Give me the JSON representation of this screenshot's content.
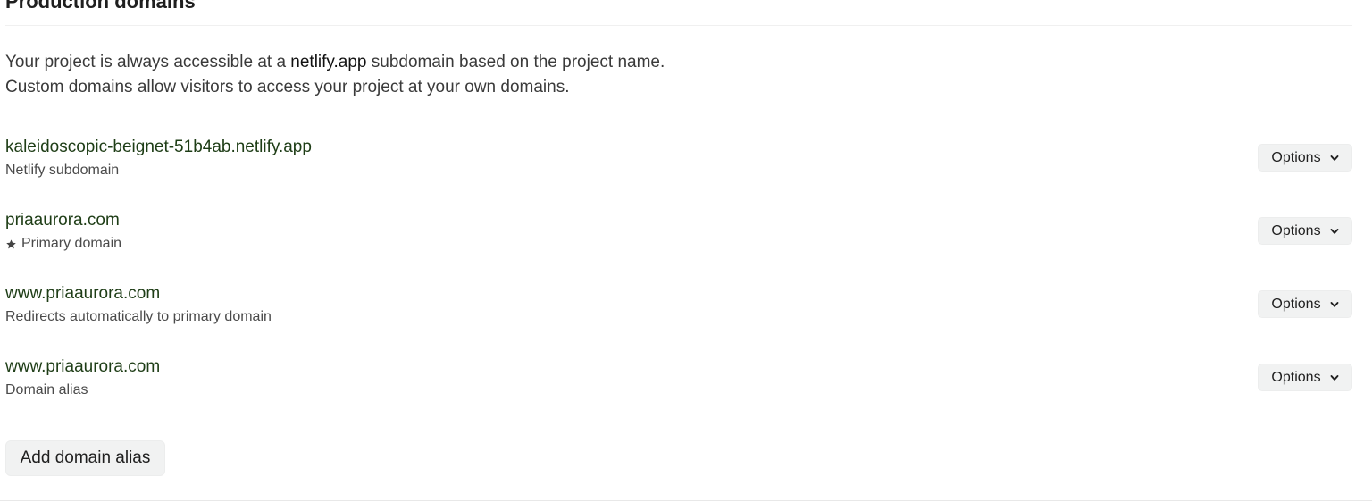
{
  "section": {
    "title": "Production domains"
  },
  "intro": {
    "line1_before": "Your project is always accessible at a ",
    "line1_bold": "netlify.app",
    "line1_after": " subdomain based on the project name.",
    "line2": "Custom domains allow visitors to access your project at your own domains."
  },
  "domains": [
    {
      "name": "kaleidoscopic-beignet-51b4ab.netlify.app",
      "description": "Netlify subdomain",
      "options_label": "Options"
    },
    {
      "name": "priaaurora.com",
      "description": "Primary domain",
      "icon": "star-icon",
      "options_label": "Options"
    },
    {
      "name": "www.priaaurora.com",
      "description": "Redirects automatically to primary domain",
      "options_label": "Options"
    },
    {
      "name": "www.priaaurora.com",
      "description": "Domain alias",
      "options_label": "Options"
    }
  ],
  "add_button": {
    "label": "Add domain alias"
  },
  "colors": {
    "domain_link": "#1e3d16",
    "button_bg": "#f1f2f2"
  }
}
